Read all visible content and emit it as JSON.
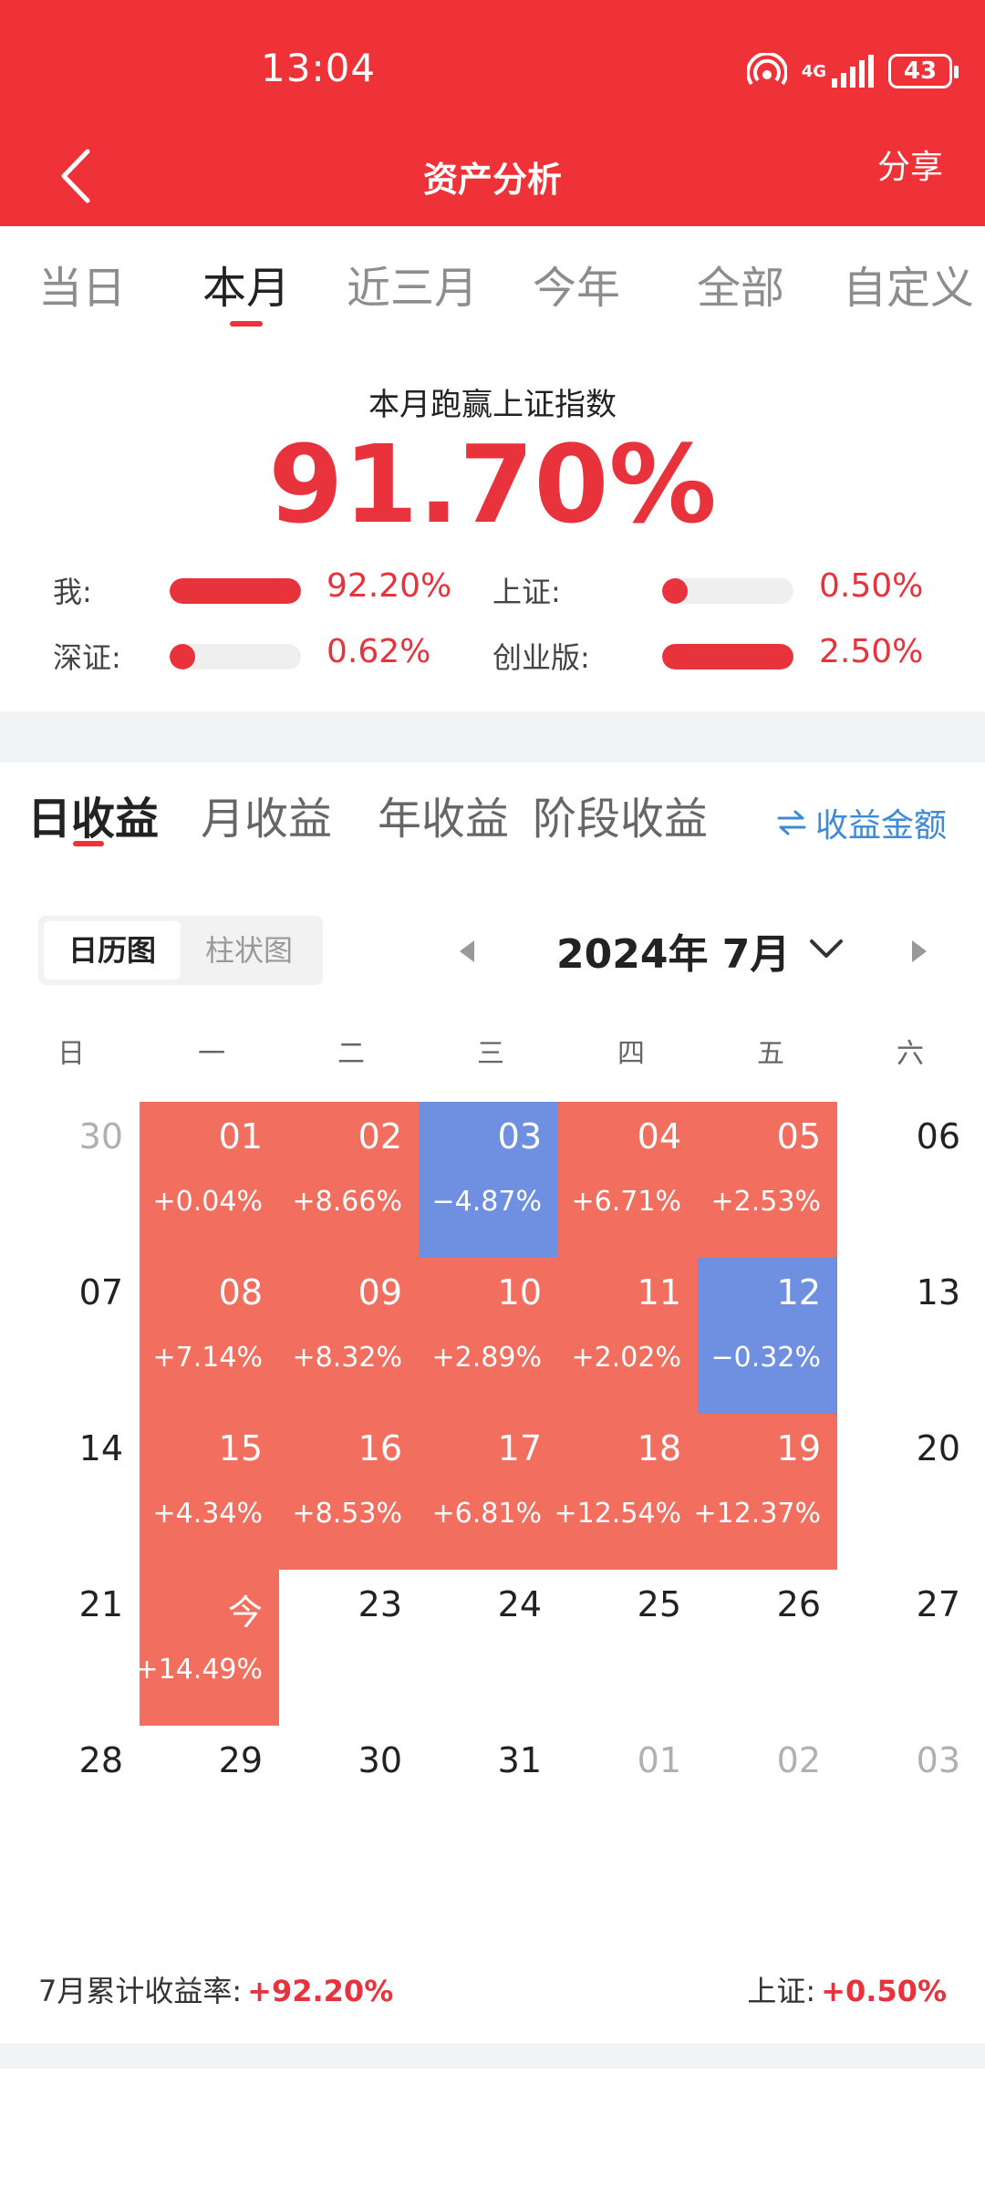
{
  "status_bar": {
    "time": "13:04",
    "network": "4G",
    "battery": "43"
  },
  "header": {
    "title": "资产分析",
    "share_label": "分享"
  },
  "period_tabs": [
    "当日",
    "本月",
    "近三月",
    "今年",
    "全部",
    "自定义"
  ],
  "summary": {
    "beat_label": "本月跑赢上证指数",
    "beat_value": "91.70%",
    "comparisons": [
      {
        "label": "我:",
        "value": "92.20%",
        "fill": 1.0
      },
      {
        "label": "上证:",
        "value": "0.50%",
        "fill": 0.0
      },
      {
        "label": "深证:",
        "value": "0.62%",
        "fill": 0.0
      },
      {
        "label": "创业版:",
        "value": "2.50%",
        "fill": 1.0
      }
    ]
  },
  "profit_tabs": [
    "日收益",
    "月收益",
    "年收益",
    "阶段收益"
  ],
  "amount_toggle": "收益金额",
  "view_switch": {
    "calendar": "日历图",
    "bar": "柱状图"
  },
  "month": "2024年 7月",
  "weekdays": [
    "日",
    "一",
    "二",
    "三",
    "四",
    "五",
    "六"
  ],
  "calendar_weeks": [
    [
      {
        "d": "30",
        "s": "muted"
      },
      {
        "d": "01",
        "p": "+0.04%",
        "s": "up"
      },
      {
        "d": "02",
        "p": "+8.66%",
        "s": "up"
      },
      {
        "d": "03",
        "p": "−4.87%",
        "s": "down"
      },
      {
        "d": "04",
        "p": "+6.71%",
        "s": "up"
      },
      {
        "d": "05",
        "p": "+2.53%",
        "s": "up"
      },
      {
        "d": "06",
        "s": "plain"
      }
    ],
    [
      {
        "d": "07",
        "s": "plain"
      },
      {
        "d": "08",
        "p": "+7.14%",
        "s": "up"
      },
      {
        "d": "09",
        "p": "+8.32%",
        "s": "up"
      },
      {
        "d": "10",
        "p": "+2.89%",
        "s": "up"
      },
      {
        "d": "11",
        "p": "+2.02%",
        "s": "up"
      },
      {
        "d": "12",
        "p": "−0.32%",
        "s": "down"
      },
      {
        "d": "13",
        "s": "plain"
      }
    ],
    [
      {
        "d": "14",
        "s": "plain"
      },
      {
        "d": "15",
        "p": "+4.34%",
        "s": "up"
      },
      {
        "d": "16",
        "p": "+8.53%",
        "s": "up"
      },
      {
        "d": "17",
        "p": "+6.81%",
        "s": "up"
      },
      {
        "d": "18",
        "p": "+12.54%",
        "s": "up"
      },
      {
        "d": "19",
        "p": "+12.37%",
        "s": "up"
      },
      {
        "d": "20",
        "s": "plain"
      }
    ],
    [
      {
        "d": "21",
        "s": "plain"
      },
      {
        "d": "今",
        "p": "+14.49%",
        "s": "up"
      },
      {
        "d": "23",
        "s": "plain"
      },
      {
        "d": "24",
        "s": "plain"
      },
      {
        "d": "25",
        "s": "plain"
      },
      {
        "d": "26",
        "s": "plain"
      },
      {
        "d": "27",
        "s": "plain"
      }
    ],
    [
      {
        "d": "28",
        "s": "plain"
      },
      {
        "d": "29",
        "s": "plain"
      },
      {
        "d": "30",
        "s": "plain"
      },
      {
        "d": "31",
        "s": "plain"
      },
      {
        "d": "01",
        "s": "muted"
      },
      {
        "d": "02",
        "s": "muted"
      },
      {
        "d": "03",
        "s": "muted"
      }
    ]
  ],
  "footer": {
    "cumulative_label": "7月累计收益率:",
    "cumulative_value": "+92.20%",
    "index_label": "上证:",
    "index_value": "+0.50%"
  },
  "colors": {
    "brand_red": "#ee3237",
    "up": "#f26e5f",
    "down": "#6f8fe0",
    "link_blue": "#3d8ad8"
  }
}
